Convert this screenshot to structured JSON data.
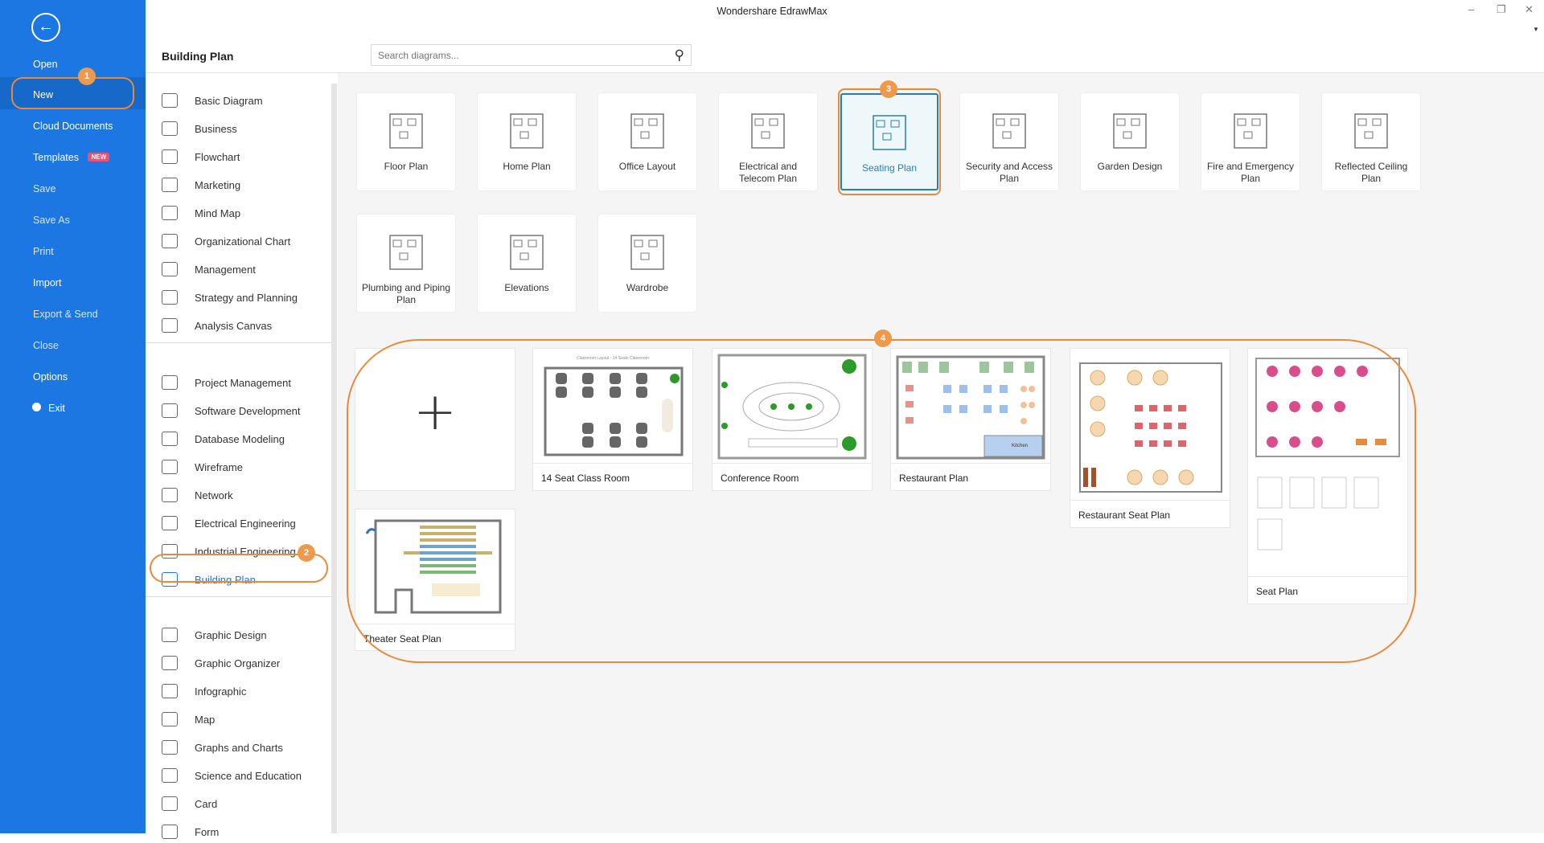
{
  "window": {
    "title": "Wondershare EdrawMax"
  },
  "leftnav": {
    "items": [
      {
        "label": "Open"
      },
      {
        "label": "New"
      },
      {
        "label": "Cloud Documents"
      },
      {
        "label": "Templates",
        "badge": "NEW"
      },
      {
        "label": "Save"
      },
      {
        "label": "Save As"
      },
      {
        "label": "Print"
      },
      {
        "label": "Import"
      },
      {
        "label": "Export & Send"
      },
      {
        "label": "Close"
      },
      {
        "label": "Options"
      },
      {
        "label": "Exit"
      }
    ]
  },
  "steps": {
    "s1": "1",
    "s2": "2",
    "s3": "3",
    "s4": "4"
  },
  "category_panel": {
    "title": "Building Plan",
    "group1": [
      "Basic Diagram",
      "Business",
      "Flowchart",
      "Marketing",
      "Mind Map",
      "Organizational Chart",
      "Management",
      "Strategy and Planning",
      "Analysis Canvas"
    ],
    "group2": [
      "Project Management",
      "Software Development",
      "Database Modeling",
      "Wireframe",
      "Network",
      "Electrical Engineering",
      "Industrial Engineering",
      "Building Plan"
    ],
    "group3": [
      "Graphic Design",
      "Graphic Organizer",
      "Infographic",
      "Map",
      "Graphs and Charts",
      "Science and Education",
      "Card",
      "Form"
    ],
    "selected": "Building Plan"
  },
  "search": {
    "placeholder": "Search diagrams..."
  },
  "diagram_types": [
    "Floor Plan",
    "Home Plan",
    "Office Layout",
    "Electrical and Telecom Plan",
    "Seating Plan",
    "Security and Access Plan",
    "Garden Design",
    "Fire and Emergency Plan",
    "Reflected Ceiling Plan",
    "Plumbing and Piping Plan",
    "Elevations",
    "Wardrobe"
  ],
  "selected_type": "Seating Plan",
  "templates": {
    "blank": "+",
    "items": [
      "14 Seat Class Room",
      "Conference Room",
      "Restaurant Plan",
      "Restaurant Seat Plan",
      "Seat Plan",
      "Theater Seat Plan"
    ],
    "classroom_thumb_title": "Classroom Layout - 14 Seats Classroom",
    "kitchen_label": "Kitchen"
  },
  "colors": {
    "nav": "#1d77e2",
    "highlight": "#e88a3c",
    "selected": "#2a7fa6"
  }
}
